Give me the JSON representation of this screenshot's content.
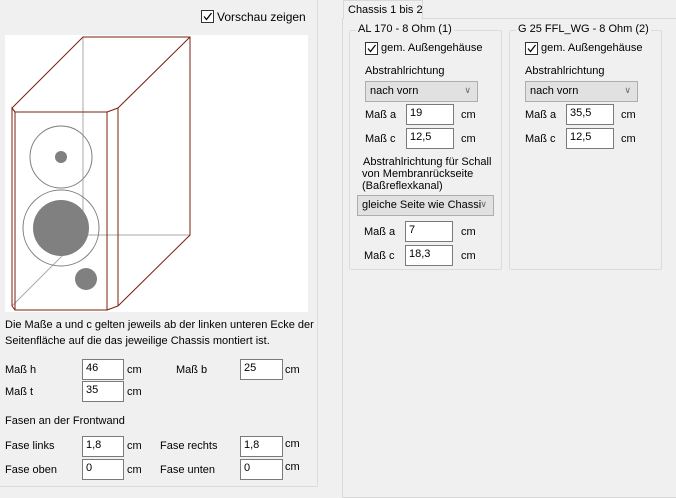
{
  "preview": {
    "checkbox_label": "Vorschau zeigen",
    "checked": true
  },
  "info_text": [
    "Die Maße a und c gelten jeweils ab der linken unteren Ecke der",
    "Seitenfläche auf die das jeweilige Chassis montiert ist."
  ],
  "dims": {
    "h_label": "Maß h",
    "h": "46",
    "b_label": "Maß b",
    "b": "25",
    "t_label": "Maß t",
    "t": "35",
    "unit": "cm"
  },
  "bevels": {
    "title": "Fasen an der Frontwand",
    "links_label": "Fase links",
    "links": "1,8",
    "rechts_label": "Fase rechts",
    "rechts": "1,8",
    "oben_label": "Fase oben",
    "oben": "0",
    "unten_label": "Fase unten",
    "unten": "0"
  },
  "tab": {
    "label": "Chassis 1 bis 2"
  },
  "chassis": [
    {
      "title": "AL 170 - 8 Ohm (1)",
      "housing_label": "gem. Außengehäuse",
      "dir_label": "Abstrahlrichtung",
      "dir": "nach vorn",
      "a_label": "Maß a",
      "a": "19",
      "c_label": "Maß c",
      "c": "12,5",
      "unit": "cm",
      "rear_label": [
        "Abstrahlrichtung für Schall",
        "von Membranrückseite",
        "(Baßreflexkanal)"
      ],
      "rear_dir": "gleiche Seite wie Chassi",
      "rear_a": "7",
      "rear_c": "18,3"
    },
    {
      "title": "G 25 FFL_WG - 8 Ohm (2)",
      "housing_label": "gem. Außengehäuse",
      "dir_label": "Abstrahlrichtung",
      "dir": "nach vorn",
      "a_label": "Maß a",
      "a": "35,5",
      "c_label": "Maß c",
      "c": "12,5",
      "unit": "cm"
    }
  ],
  "colors": {
    "cabinet_edge": "#7a1f0f",
    "driver": "#808080"
  }
}
